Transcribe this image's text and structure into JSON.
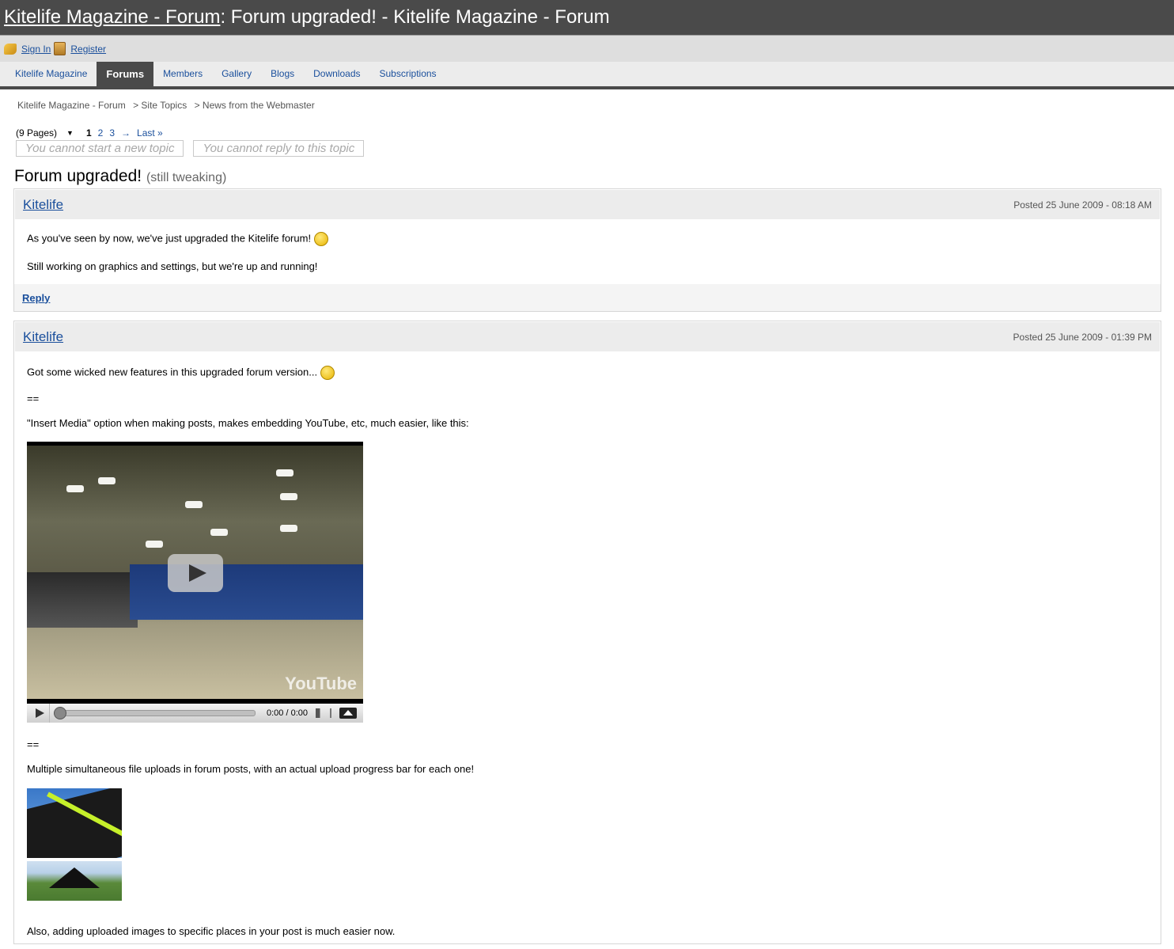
{
  "title_bar": {
    "link": "Kitelife Magazine - Forum",
    "rest": ": Forum upgraded! - Kitelife Magazine - Forum"
  },
  "user_bar": {
    "sign_in": "Sign In",
    "register": "Register"
  },
  "nav": [
    "Kitelife Magazine",
    "Forums",
    "Members",
    "Gallery",
    "Blogs",
    "Downloads",
    "Subscriptions"
  ],
  "breadcrumb": [
    "Kitelife Magazine - Forum",
    "> Site Topics",
    "> News from the Webmaster"
  ],
  "pager": {
    "pages": "(9 Pages)",
    "current": "1",
    "p2": "2",
    "p3": "3",
    "next": "→",
    "last": "Last »"
  },
  "buttons": {
    "new_topic": "You cannot start a new topic",
    "reply_topic": "You cannot reply to this topic"
  },
  "topic": {
    "title": "Forum upgraded!",
    "subtitle": "(still tweaking)"
  },
  "posts": [
    {
      "author": "Kitelife",
      "date": "Posted 25 June 2009 - 08:18 AM",
      "line1": "As you've seen by now, we've just upgraded the Kitelife forum!",
      "line2": "Still working on graphics and settings, but we're up and running!",
      "reply": "Reply"
    },
    {
      "author": "Kitelife",
      "date": "Posted 25 June 2009 - 01:39 PM",
      "line1": "Got some wicked new features in this upgraded forum version...",
      "sep1": "==",
      "line2": "\"Insert Media\" option when making posts, makes embedding YouTube, etc, much easier, like this:",
      "video_time": "0:00 / 0:00",
      "video_logo": "YouTube",
      "sep2": "==",
      "line3": "Multiple simultaneous file uploads in forum posts, with an actual upload progress bar for each one!",
      "line4": "Also, adding uploaded images to specific places in your post is much easier now."
    }
  ]
}
